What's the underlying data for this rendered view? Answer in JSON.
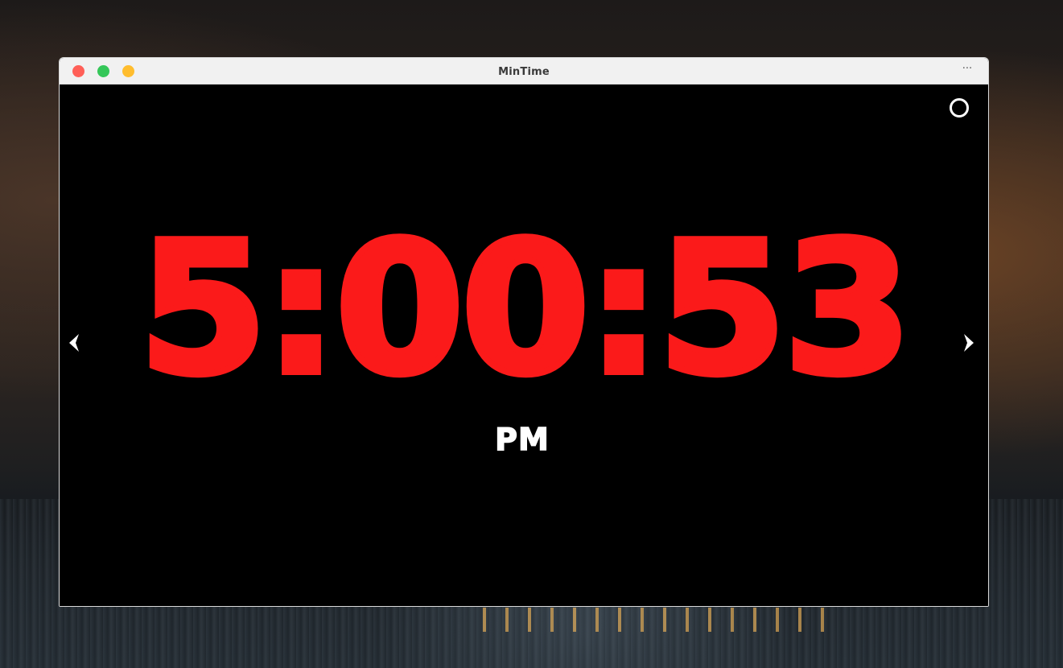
{
  "window": {
    "title": "MinTime",
    "menu_icon": "more-horizontal-icon",
    "menu_glyph": "···",
    "traffic_lights": {
      "close_color": "#ff5f57",
      "maximize_color": "#35c759",
      "minimize_color": "#ffbd2e"
    }
  },
  "clock": {
    "time": "5:00:53",
    "meridiem": "PM",
    "time_color": "#fb1a1a",
    "meridiem_color": "#ffffff",
    "background_color": "#000000"
  },
  "controls": {
    "settings_icon": "circle-icon",
    "prev_icon": "chevron-left-icon",
    "next_icon": "chevron-right-icon"
  }
}
